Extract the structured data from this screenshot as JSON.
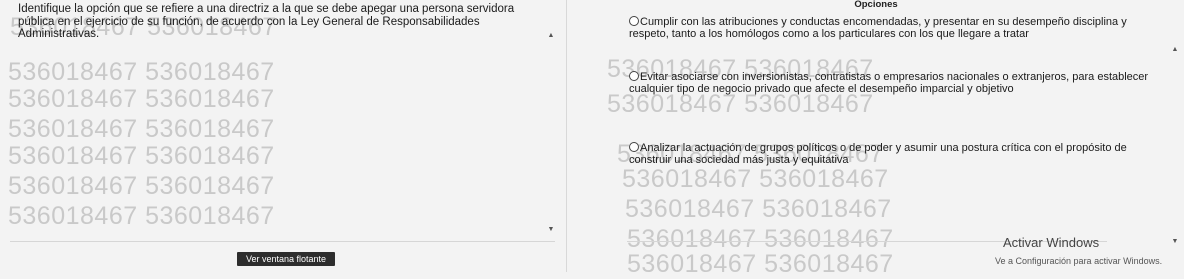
{
  "question": {
    "text": "Identifique la opción que se refiere a una directriz a la que se debe apegar una persona servidora pública en el ejercicio de su función, de acuerdo con la Ley General de Responsabilidades Administrativas."
  },
  "options": {
    "header": "Opciones",
    "items": [
      {
        "label": "Cumplir con las atribuciones y conductas encomendadas, y presentar en su desempeño disciplina y respeto, tanto a los homólogos como a los particulares con los que llegare a tratar"
      },
      {
        "label": "Evitar asociarse con inversionistas, contratistas o empresarios nacionales o extranjeros, para establecer cualquier tipo de negocio privado que afecte el desempeño imparcial y objetivo"
      },
      {
        "label": "Analizar la actuación de grupos políticos o de poder y asumir una postura crítica con el propósito de construir una sociedad más justa y equitativa"
      }
    ]
  },
  "watermark": {
    "text": "536018467",
    "left_lines": [
      "536018467 536018467",
      "536018467 536018467",
      "536018467 536018467",
      "536018467 536018467",
      "536018467 536018467",
      "536018467 536018467",
      "536018467 536018467"
    ],
    "right_lines": [
      "536018467 536018467",
      "536018467 536018467",
      "536018467 536018467",
      "536018467 536018467",
      "536018467 536018467",
      "536018467 536018467",
      "536018467 536018467"
    ]
  },
  "floating_button": {
    "label": "Ver ventana flotante"
  },
  "windows_activation": {
    "title": "Activar Windows",
    "subtitle": "Ve a Configuración para activar Windows."
  }
}
